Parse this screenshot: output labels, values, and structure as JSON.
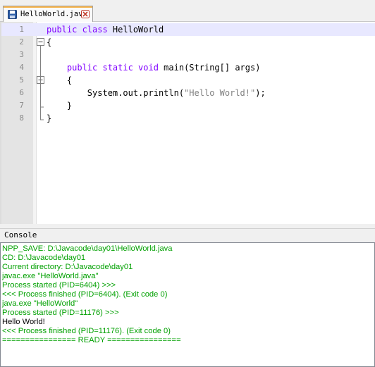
{
  "colors": {
    "keyword": "#8000ff",
    "string": "#808080",
    "console_green": "#00a000",
    "console_black": "#000000",
    "active_line": "#e8e8ff",
    "tab_accent": "#f7b54e"
  },
  "tab": {
    "filename": "HelloWorld.java",
    "save_icon": "floppy-disk-icon",
    "close_icon": "close-icon"
  },
  "editor": {
    "line_numbers": [
      "1",
      "2",
      "3",
      "4",
      "5",
      "6",
      "7",
      "8"
    ],
    "lines": [
      {
        "kw1": "public class",
        "text": " HelloWorld"
      },
      {
        "text": "{"
      },
      {
        "text": ""
      },
      {
        "indent": "    ",
        "kw1": "public static void",
        "text": " main(String[] args)"
      },
      {
        "indent": "    ",
        "text": "{"
      },
      {
        "indent": "        ",
        "pre": "System.out.println(",
        "str": "\"Hello World!\"",
        "post": ");"
      },
      {
        "indent": "    ",
        "text": "}"
      },
      {
        "text": "}"
      }
    ]
  },
  "console": {
    "title": "Console",
    "lines": [
      {
        "text": "NPP_SAVE: D:\\Javacode\\day01\\HelloWorld.java",
        "color": "green"
      },
      {
        "text": "CD: D:\\Javacode\\day01",
        "color": "green"
      },
      {
        "text": "Current directory: D:\\Javacode\\day01",
        "color": "green"
      },
      {
        "text": "javac.exe \"HelloWorld.java\"",
        "color": "green"
      },
      {
        "text": "Process started (PID=6404) >>>",
        "color": "green"
      },
      {
        "text": "<<< Process finished (PID=6404). (Exit code 0)",
        "color": "green"
      },
      {
        "text": "java.exe \"HelloWorld\"",
        "color": "green"
      },
      {
        "text": "Process started (PID=11176) >>>",
        "color": "green"
      },
      {
        "text": "Hello World!",
        "color": "black"
      },
      {
        "text": "<<< Process finished (PID=11176). (Exit code 0)",
        "color": "green"
      },
      {
        "text": "================ READY ================",
        "color": "green"
      }
    ]
  }
}
